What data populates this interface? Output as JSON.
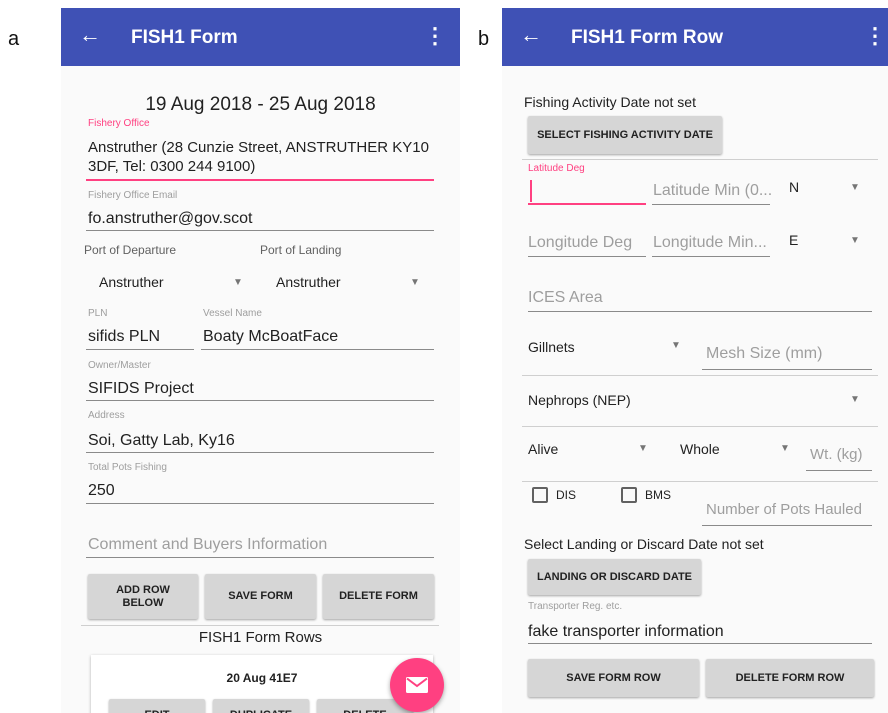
{
  "panel_a": {
    "label": "a",
    "title": "FISH1 Form",
    "date_range": "19 Aug 2018 - 25 Aug 2018",
    "fishery_office": {
      "label": "Fishery Office",
      "line1": "Anstruther (28 Cunzie Street, ANSTRUTHER KY10",
      "line2": "3DF, Tel: 0300 244 9100)"
    },
    "fishery_office_email": {
      "label": "Fishery Office Email",
      "value": "fo.anstruther@gov.scot"
    },
    "port_of_departure": {
      "label": "Port of Departure",
      "value": "Anstruther"
    },
    "port_of_landing": {
      "label": "Port of Landing",
      "value": "Anstruther"
    },
    "pln": {
      "label": "PLN",
      "value": "sifids PLN"
    },
    "vessel_name": {
      "label": "Vessel Name",
      "value": "Boaty McBoatFace"
    },
    "owner_master": {
      "label": "Owner/Master",
      "value": "SIFIDS Project"
    },
    "address": {
      "label": "Address",
      "value": "Soi, Gatty Lab, Ky16"
    },
    "total_pots": {
      "label": "Total Pots Fishing",
      "value": "250"
    },
    "comment_placeholder": "Comment and Buyers Information",
    "buttons": {
      "add_row_line1": "ADD ROW",
      "add_row_line2": "BELOW",
      "save": "SAVE FORM",
      "delete": "DELETE FORM"
    },
    "rows_title": "FISH1 Form Rows",
    "row_card": {
      "title": "20 Aug 41E7",
      "edit": "EDIT",
      "duplicate": "DUPLICATE",
      "delete": "DELETE"
    },
    "fab_icon": "email-icon"
  },
  "panel_b": {
    "label": "b",
    "title": "FISH1 Form Row",
    "fishing_date_status": "Fishing Activity Date not set",
    "select_date_button": "SELECT FISHING ACTIVITY DATE",
    "latitude_deg_label": "Latitude Deg",
    "latitude_min_placeholder": "Latitude Min (0...",
    "lat_hemisphere": "N",
    "longitude_deg_placeholder": "Longitude Deg",
    "longitude_min_placeholder": "Longitude Min...",
    "lon_hemisphere": "E",
    "ices_area_placeholder": "ICES Area",
    "gear": "Gillnets",
    "mesh_size_placeholder": "Mesh Size (mm)",
    "species": "Nephrops (NEP)",
    "state": "Alive",
    "presentation": "Whole",
    "weight_placeholder": "Wt. (kg)",
    "dis_label": "DIS",
    "bms_label": "BMS",
    "pots_hauled_placeholder": "Number of Pots Hauled",
    "landing_date_status": "Select Landing or Discard Date not set",
    "landing_date_button": "LANDING OR DISCARD DATE",
    "transporter": {
      "label": "Transporter Reg. etc.",
      "value": "fake transporter information"
    },
    "buttons": {
      "save": "SAVE FORM ROW",
      "delete": "DELETE FORM ROW"
    }
  },
  "colors": {
    "app_bar": "#3f51b5",
    "accent": "#ff4081",
    "button_bg": "#d6d6d6"
  }
}
